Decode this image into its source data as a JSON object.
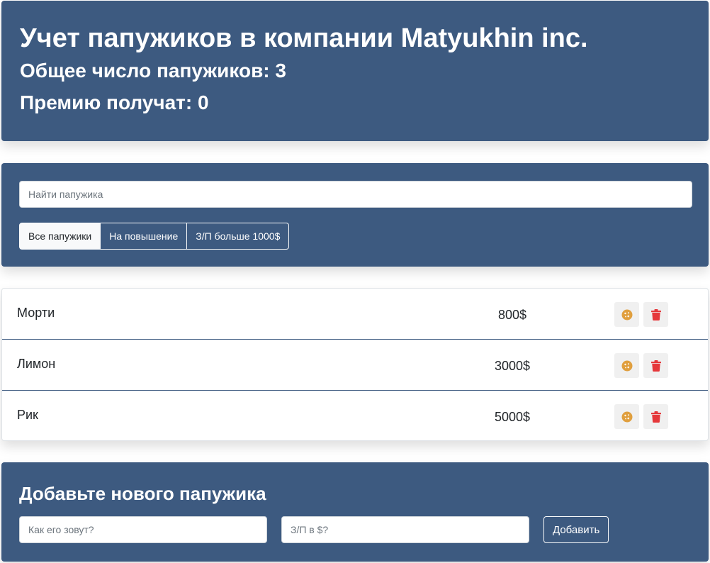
{
  "header": {
    "title": "Учет папужиков в компании Matyukhin inc.",
    "total_label": "Общее число папужиков: 3",
    "bonus_label": "Премию получат: 0"
  },
  "search": {
    "placeholder": "Найти папужика",
    "value": "",
    "filters": [
      {
        "label": "Все папужики",
        "active": true
      },
      {
        "label": "На повышение",
        "active": false
      },
      {
        "label": "З/П больше 1000$",
        "active": false
      }
    ]
  },
  "employees": [
    {
      "name": "Морти",
      "salary": "800$",
      "cookie_icon": "cookie-icon",
      "trash_icon": "trash-icon"
    },
    {
      "name": "Лимон",
      "salary": "3000$",
      "cookie_icon": "cookie-icon",
      "trash_icon": "trash-icon"
    },
    {
      "name": "Рик",
      "salary": "5000$",
      "cookie_icon": "cookie-icon",
      "trash_icon": "trash-icon"
    }
  ],
  "add_form": {
    "title": "Добавьте нового папужика",
    "name_placeholder": "Как его зовут?",
    "salary_placeholder": "З/П в $?",
    "submit_label": "Добавить"
  },
  "colors": {
    "panel": "#3d5a80",
    "cookie": "#e09f3e",
    "trash": "#e5383b",
    "divider": "#3d5a80"
  }
}
